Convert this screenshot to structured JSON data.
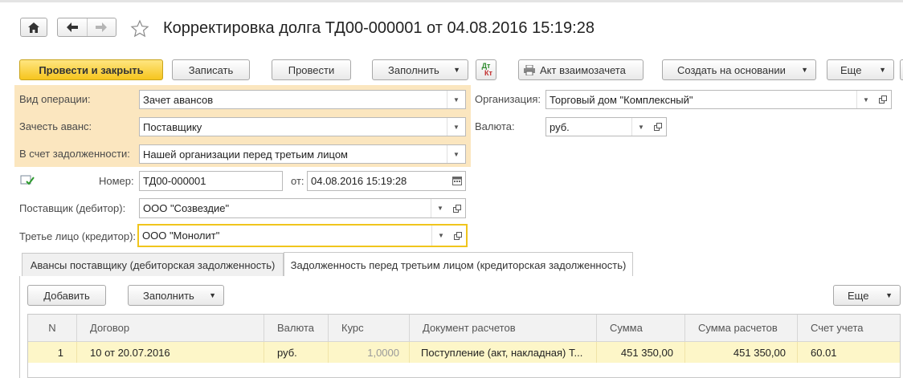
{
  "window": {
    "title": "Корректировка долга ТД00-000001 от 04.08.2016 15:19:28"
  },
  "toolbar": {
    "post_close": "Провести и закрыть",
    "save": "Записать",
    "post": "Провести",
    "fill": "Заполнить",
    "dtkt_top": "Дт",
    "dtkt_bottom": "Кт",
    "offset_act": "Акт взаимозачета",
    "create_based": "Создать на основании",
    "more": "Еще"
  },
  "form": {
    "operation_label": "Вид операции:",
    "operation_value": "Зачет авансов",
    "advance_label": "Зачесть аванс:",
    "advance_value": "Поставщику",
    "debt_label": "В счет задолженности:",
    "debt_value": "Нашей организации перед третьим лицом",
    "number_label": "Номер:",
    "number_value": "ТД00-000001",
    "date_label": "от:",
    "date_value": "04.08.2016 15:19:28",
    "supplier_label": "Поставщик (дебитор):",
    "supplier_value": "ООО \"Созвездие\"",
    "third_label": "Третье лицо (кредитор):",
    "third_value": "ООО \"Монолит\"",
    "org_label": "Организация:",
    "org_value": "Торговый дом \"Комплексный\"",
    "currency_label": "Валюта:",
    "currency_value": "руб."
  },
  "tabs": [
    {
      "label": "Авансы поставщику (дебиторская задолженность)"
    },
    {
      "label": "Задолженность перед третьим лицом (кредиторская задолженность)"
    }
  ],
  "table_toolbar": {
    "add": "Добавить",
    "fill": "Заполнить",
    "more": "Еще"
  },
  "table": {
    "columns": [
      "N",
      "Договор",
      "Валюта",
      "Курс",
      "Документ расчетов",
      "Сумма",
      "Сумма расчетов",
      "Счет учета"
    ],
    "rows": [
      {
        "n": "1",
        "contract": "10 от 20.07.2016",
        "currency": "руб.",
        "rate": "1,0000",
        "document": "Поступление (акт, накладная) Т...",
        "sum": "451 350,00",
        "sum_settle": "451 350,00",
        "account": "60.01"
      }
    ]
  },
  "colors": {
    "accent_yellow": "#f6c51e",
    "highlight": "#fbe6bf",
    "selected_row": "#fdf6c8"
  }
}
